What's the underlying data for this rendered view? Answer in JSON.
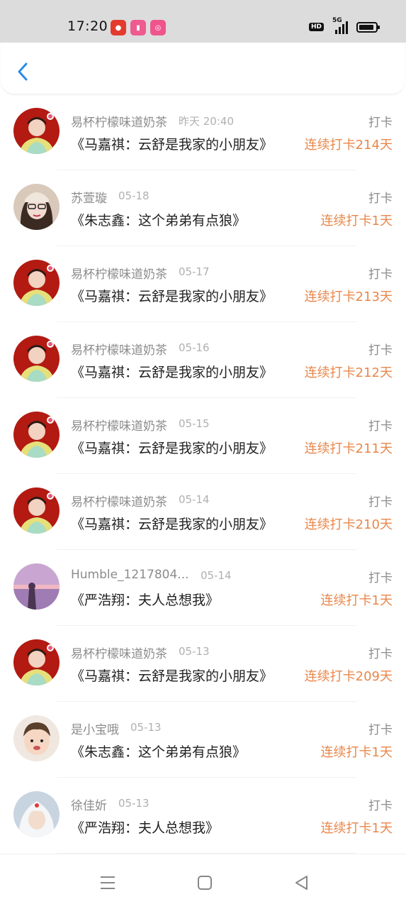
{
  "status_bar": {
    "time": "17:20",
    "network_badge": "HD",
    "network_type": "5G",
    "app_icons": [
      "news-app-icon",
      "video-app-icon",
      "shop-app-icon"
    ]
  },
  "header": {
    "back_icon": "chevron-left-icon"
  },
  "colors": {
    "accent": "#e9874a",
    "back": "#2b8ce6",
    "name": "#8c8c8c",
    "date": "#b0b0b0",
    "title": "#222222"
  },
  "records": [
    {
      "user": "易杯柠檬味道奶茶",
      "date": "昨天 20:40",
      "tag": "打卡",
      "book": "《马嘉祺：云舒是我家的小朋友》",
      "streak": "连续打卡214天",
      "avatar": "red"
    },
    {
      "user": "苏萱璇",
      "date": "05-18",
      "tag": "打卡",
      "book": "《朱志鑫：这个弟弟有点狼》",
      "streak": "连续打卡1天",
      "avatar": "girl"
    },
    {
      "user": "易杯柠檬味道奶茶",
      "date": "05-17",
      "tag": "打卡",
      "book": "《马嘉祺：云舒是我家的小朋友》",
      "streak": "连续打卡213天",
      "avatar": "red"
    },
    {
      "user": "易杯柠檬味道奶茶",
      "date": "05-16",
      "tag": "打卡",
      "book": "《马嘉祺：云舒是我家的小朋友》",
      "streak": "连续打卡212天",
      "avatar": "red"
    },
    {
      "user": "易杯柠檬味道奶茶",
      "date": "05-15",
      "tag": "打卡",
      "book": "《马嘉祺：云舒是我家的小朋友》",
      "streak": "连续打卡211天",
      "avatar": "red"
    },
    {
      "user": "易杯柠檬味道奶茶",
      "date": "05-14",
      "tag": "打卡",
      "book": "《马嘉祺：云舒是我家的小朋友》",
      "streak": "连续打卡210天",
      "avatar": "red"
    },
    {
      "user": "Humble_1217804...",
      "date": "05-14",
      "tag": "打卡",
      "book": "《严浩翔：夫人总想我》",
      "streak": "连续打卡1天",
      "avatar": "sunset"
    },
    {
      "user": "易杯柠檬味道奶茶",
      "date": "05-13",
      "tag": "打卡",
      "book": "《马嘉祺：云舒是我家的小朋友》",
      "streak": "连续打卡209天",
      "avatar": "red"
    },
    {
      "user": "是小宝哦",
      "date": "05-13",
      "tag": "打卡",
      "book": "《朱志鑫：这个弟弟有点狼》",
      "streak": "连续打卡1天",
      "avatar": "boy"
    },
    {
      "user": "徐佳妡",
      "date": "05-13",
      "tag": "打卡",
      "book": "《严浩翔：夫人总想我》",
      "streak": "连续打卡1天",
      "avatar": "white"
    }
  ],
  "nav": {
    "menu_icon": "menu-icon",
    "home_icon": "home-square-icon",
    "back_icon": "back-triangle-icon"
  }
}
